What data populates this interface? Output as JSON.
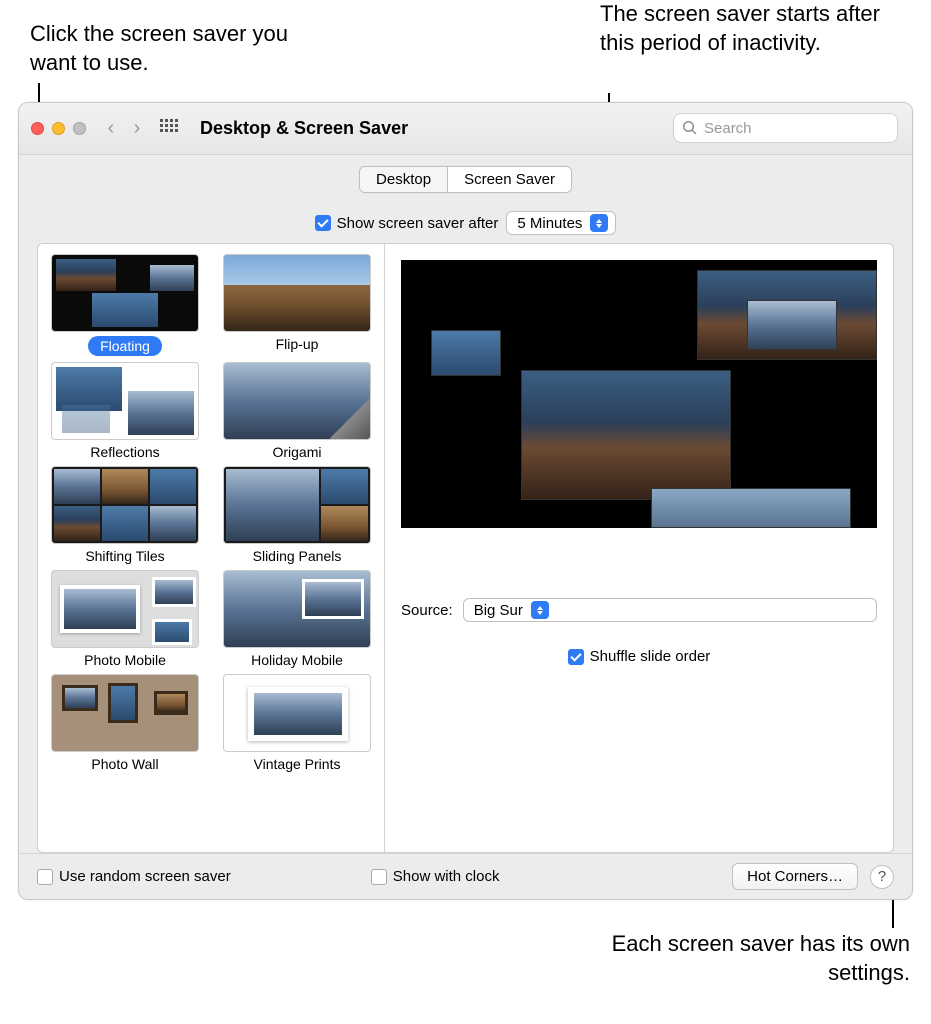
{
  "callouts": {
    "left": "Click the screen saver you want to use.",
    "right_top": "The screen saver starts after this period of inactivity.",
    "right_bottom": "Each screen saver has its own settings."
  },
  "window": {
    "title": "Desktop & Screen Saver",
    "search_placeholder": "Search"
  },
  "tabs": {
    "desktop": "Desktop",
    "screensaver": "Screen Saver"
  },
  "show_after": {
    "label": "Show screen saver after",
    "value": "5 Minutes"
  },
  "savers": [
    {
      "label": "Floating",
      "selected": true
    },
    {
      "label": "Flip-up"
    },
    {
      "label": "Reflections"
    },
    {
      "label": "Origami"
    },
    {
      "label": "Shifting Tiles"
    },
    {
      "label": "Sliding Panels"
    },
    {
      "label": "Photo Mobile"
    },
    {
      "label": "Holiday Mobile"
    },
    {
      "label": "Photo Wall"
    },
    {
      "label": "Vintage Prints"
    }
  ],
  "source": {
    "label": "Source:",
    "value": "Big Sur"
  },
  "shuffle_label": "Shuffle slide order",
  "bottom": {
    "random": "Use random screen saver",
    "clock": "Show with clock",
    "hotcorners": "Hot Corners…"
  }
}
